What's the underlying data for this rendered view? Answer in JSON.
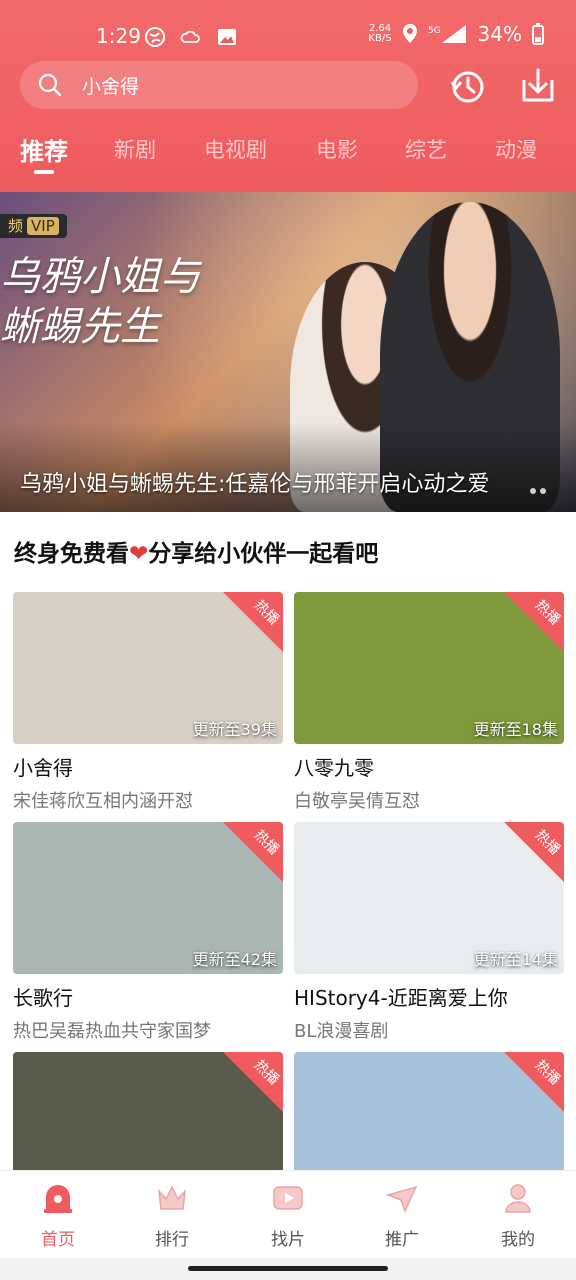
{
  "status_bar": {
    "time": "1:29",
    "speed_value": "2.64",
    "speed_unit": "KB/S",
    "network": "5G",
    "battery": "34%"
  },
  "search": {
    "placeholder": "小舍得"
  },
  "top_tabs": [
    "推荐",
    "新剧",
    "电视剧",
    "电影",
    "综艺",
    "动漫"
  ],
  "banner": {
    "vip_badge": "VIP",
    "title_art": "乌鸦小姐与蜥蜴先生",
    "caption": "乌鸦小姐与蜥蜴先生:任嘉伦与邢菲开启心动之爱"
  },
  "section": {
    "title_a": "终身免费看",
    "heart": "❤",
    "title_b": "分享给小伙伴一起看吧"
  },
  "cards": [
    {
      "name": "小舍得",
      "desc": "宋佳蒋欣互相内涵开怼",
      "update": "更新至39集",
      "badge": "热播",
      "tone": "#d7cfc4"
    },
    {
      "name": "八零九零",
      "desc": "白敬亭吴倩互怼",
      "update": "更新至18集",
      "badge": "热播",
      "tone": "#7f9a3c"
    },
    {
      "name": "长歌行",
      "desc": "热巴吴磊热血共守家国梦",
      "update": "更新至42集",
      "badge": "热播",
      "tone": "#a9b6b3"
    },
    {
      "name": "HIStory4-近距离爱上你",
      "desc": "BL浪漫喜剧",
      "update": "更新至14集",
      "badge": "热播",
      "tone": "#e8ecee"
    },
    {
      "name": "",
      "desc": "",
      "update": "",
      "badge": "热播",
      "tone": "#5a5a48"
    },
    {
      "name": "",
      "desc": "",
      "update": "",
      "badge": "热播",
      "tone": "#a6c1d9"
    }
  ],
  "bottom_nav": [
    {
      "label": "首页",
      "icon": "home-icon",
      "active": true
    },
    {
      "label": "排行",
      "icon": "crown-icon",
      "active": false
    },
    {
      "label": "找片",
      "icon": "play-icon",
      "active": false
    },
    {
      "label": "推广",
      "icon": "send-icon",
      "active": false
    },
    {
      "label": "我的",
      "icon": "user-icon",
      "active": false
    }
  ],
  "colors": {
    "accent": "#ef5b5f",
    "header_top": "#f26a6a"
  }
}
